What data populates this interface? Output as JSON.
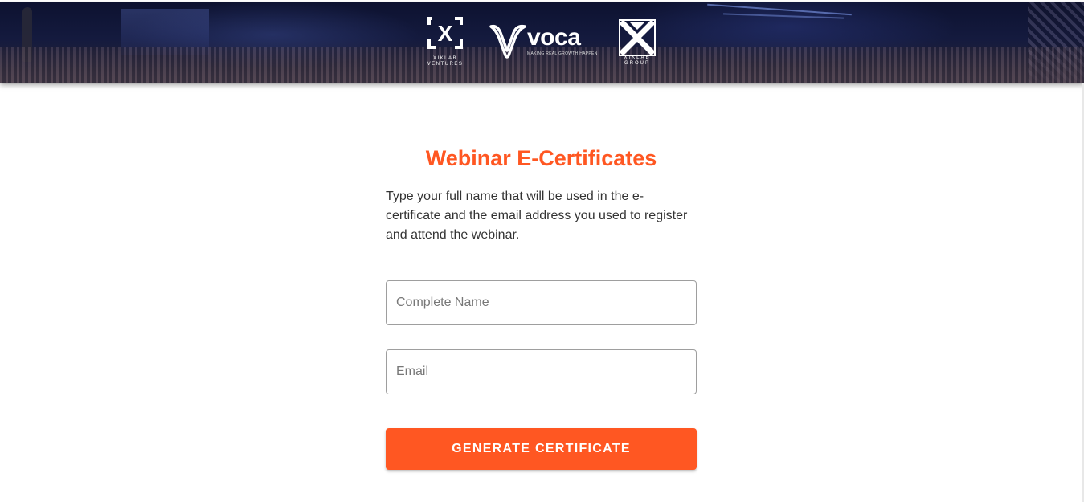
{
  "header": {
    "logos": [
      {
        "name": "xiklab-ventures-logo",
        "glyph": "X",
        "subtitle": "XIKLAB VENTURES"
      },
      {
        "name": "voca-logo",
        "wordmark": "voca",
        "tagline": "MAKING REAL GROWTH HAPPEN"
      },
      {
        "name": "xiklab-group-logo",
        "subtitle": "XIKLAB GROUP"
      }
    ]
  },
  "form": {
    "title": "Webinar E-Certificates",
    "description": "Type your full name that will be used in the e-certificate and the email address you used to register and attend the webinar.",
    "name_field": {
      "placeholder": "Complete Name",
      "value": ""
    },
    "email_field": {
      "placeholder": "Email",
      "value": ""
    },
    "submit_label": "Generate Certificate"
  },
  "colors": {
    "accent": "#ff5722",
    "banner": "#141a3e",
    "input_border": "#9e9e9e"
  }
}
